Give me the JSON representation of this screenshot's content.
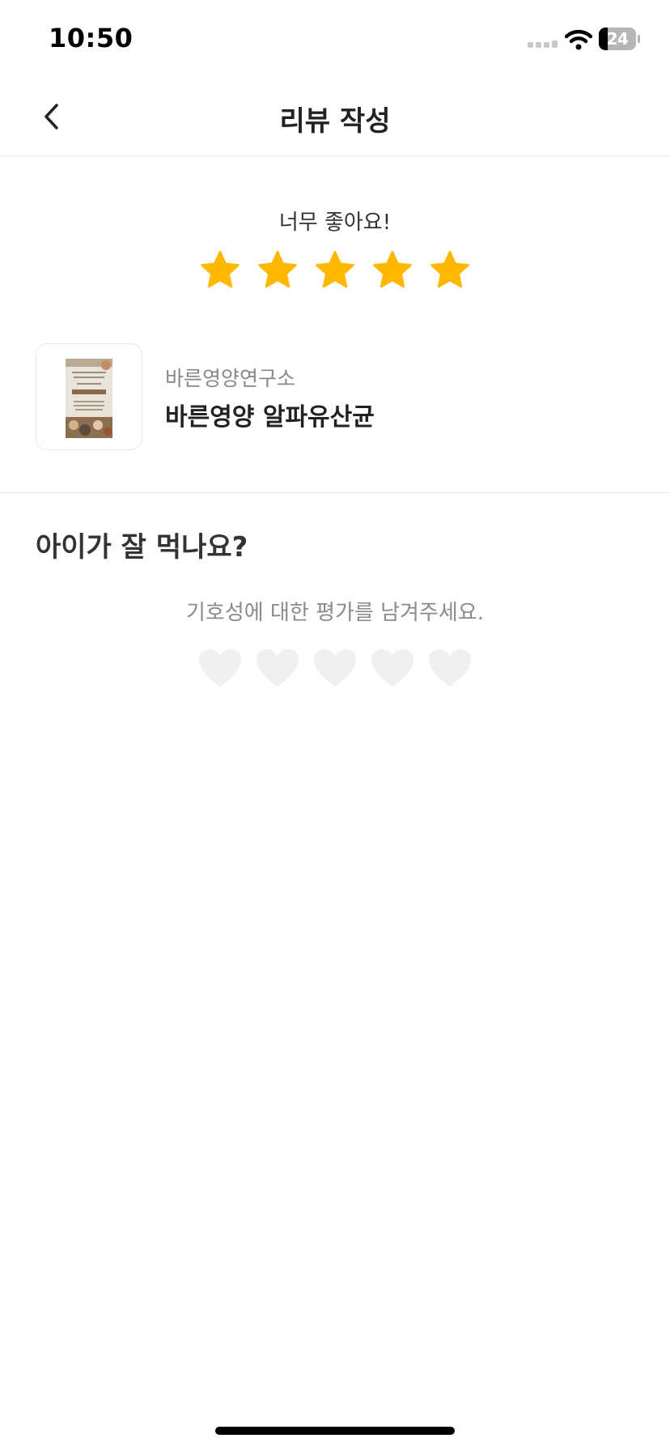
{
  "status_bar": {
    "time": "10:50",
    "battery_level": "24",
    "battery_fraction": 0.24
  },
  "header": {
    "title": "리뷰 작성",
    "back_icon": "chevron-left-icon"
  },
  "rating": {
    "caption": "너무 좋아요!",
    "value": 5,
    "max": 5,
    "star_color": "#FFB800"
  },
  "product": {
    "brand": "바른영양연구소",
    "name": "바른영양 알파유산균"
  },
  "preference": {
    "question": "아이가 잘 먹나요?",
    "caption": "기호성에 대한 평가를 남겨주세요.",
    "value": 0,
    "max": 5,
    "heart_color": "#EEF0F2"
  }
}
